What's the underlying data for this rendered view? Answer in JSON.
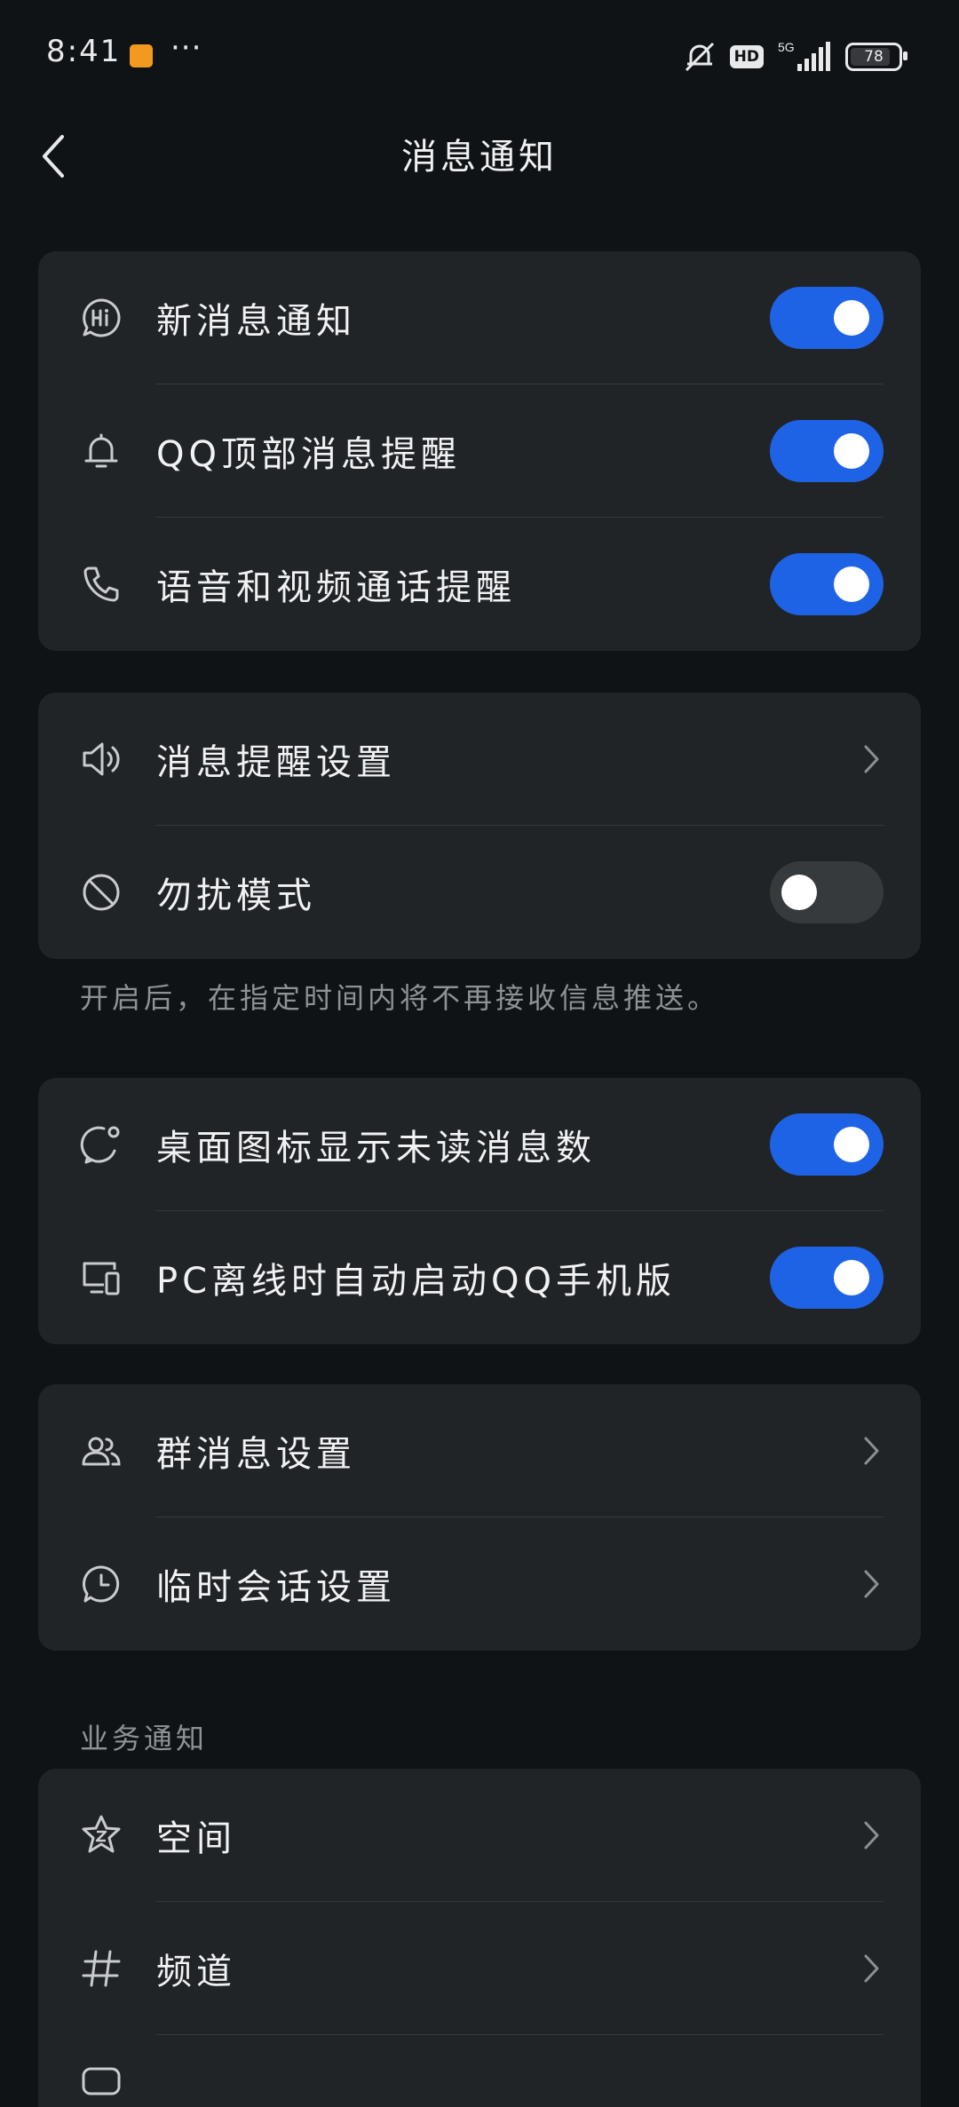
{
  "status_bar": {
    "time": "8:41",
    "more": "···",
    "hd": "HD",
    "network": "5G",
    "battery": "78"
  },
  "header": {
    "title": "消息通知",
    "back_icon": "chevron-left-icon"
  },
  "group1": [
    {
      "label": "新消息通知",
      "icon": "hi-bubble-icon",
      "toggle": "on"
    },
    {
      "label": "QQ顶部消息提醒",
      "icon": "bell-icon",
      "toggle": "on"
    },
    {
      "label": "语音和视频通话提醒",
      "icon": "phone-icon",
      "toggle": "on"
    }
  ],
  "group2": [
    {
      "label": "消息提醒设置",
      "icon": "speaker-icon",
      "control": "chevron"
    },
    {
      "label": "勿扰模式",
      "icon": "block-icon",
      "toggle": "off"
    }
  ],
  "dnd_hint": "开启后，在指定时间内将不再接收信息推送。",
  "group3": [
    {
      "label": "桌面图标显示未读消息数",
      "icon": "badge-bubble-icon",
      "toggle": "on"
    },
    {
      "label": "PC离线时自动启动QQ手机版",
      "icon": "devices-icon",
      "toggle": "on"
    }
  ],
  "group4": [
    {
      "label": "群消息设置",
      "icon": "group-icon",
      "control": "chevron"
    },
    {
      "label": "临时会话设置",
      "icon": "clock-bubble-icon",
      "control": "chevron"
    }
  ],
  "business_section_title": "业务通知",
  "group5": [
    {
      "label": "空间",
      "icon": "star-icon",
      "control": "chevron"
    },
    {
      "label": "频道",
      "icon": "hash-icon",
      "control": "chevron"
    }
  ],
  "colors": {
    "accent": "#1E63E6",
    "background": "#101316",
    "card": "#212427"
  }
}
